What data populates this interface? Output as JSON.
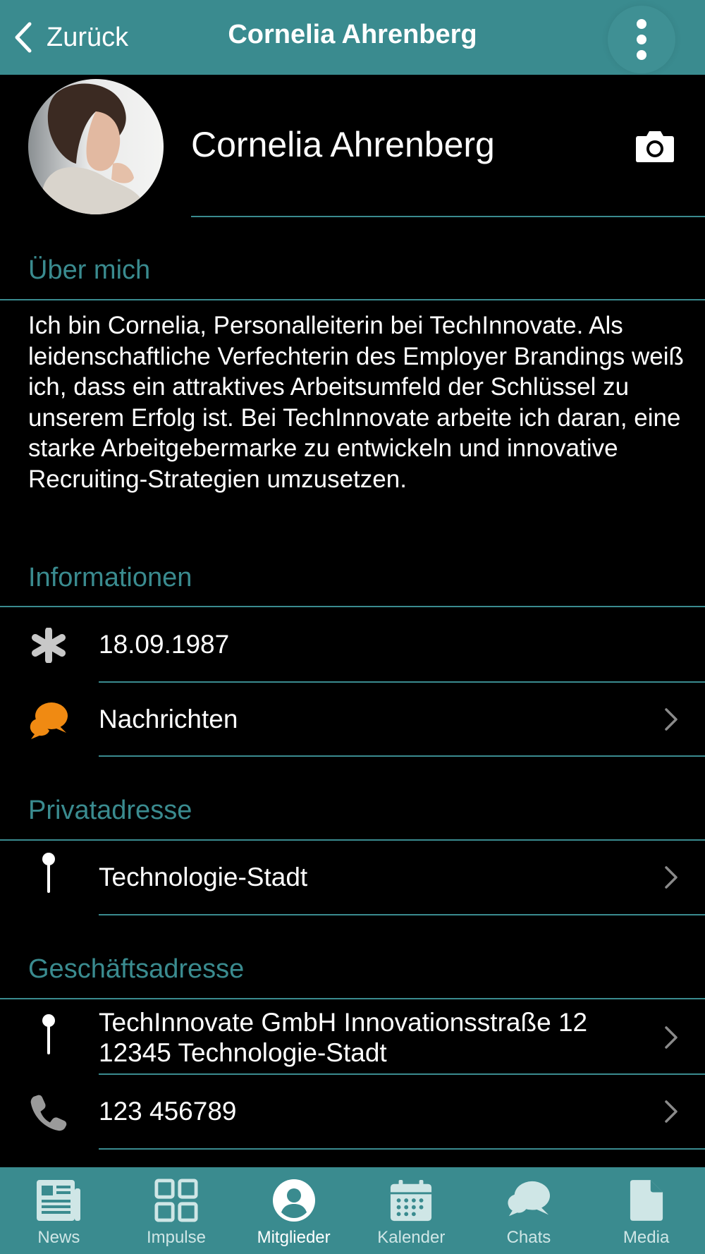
{
  "header": {
    "back_label": "Zurück",
    "title": "Cornelia Ahrenberg"
  },
  "profile": {
    "name": "Cornelia Ahrenberg"
  },
  "about": {
    "heading": "Über mich",
    "text": "Ich bin Cornelia, Personalleiterin bei TechInnovate. Als leidenschaftliche Verfechterin des Employer Brandings weiß ich, dass ein attraktives Arbeitsumfeld der Schlüssel zu unserem Erfolg ist. Bei TechInnovate arbeite ich daran, eine starke Arbeitgebermarke zu entwickeln und innovative Recruiting-Strategien umzusetzen."
  },
  "info": {
    "heading": "Informationen",
    "birthday": "18.09.1987",
    "messages_label": "Nachrichten"
  },
  "private_address": {
    "heading": "Privatadresse",
    "city": "Technologie-Stadt"
  },
  "business_address": {
    "heading": "Geschäftsadresse",
    "line1": "TechInnovate GmbH Innovationsstraße 12",
    "line2": "12345 Technologie-Stadt",
    "phone": "123 456789"
  },
  "nav": {
    "items": [
      {
        "label": "News",
        "icon": "news-icon"
      },
      {
        "label": "Impulse",
        "icon": "grid-icon"
      },
      {
        "label": "Mitglieder",
        "icon": "user-circle-icon"
      },
      {
        "label": "Kalender",
        "icon": "calendar-icon"
      },
      {
        "label": "Chats",
        "icon": "chat-bubble-icon"
      },
      {
        "label": "Media",
        "icon": "document-icon"
      }
    ],
    "active": "Mitglieder"
  },
  "colors": {
    "accent": "#3a8b8f",
    "background": "#000000",
    "messages_icon": "#f08a12"
  }
}
